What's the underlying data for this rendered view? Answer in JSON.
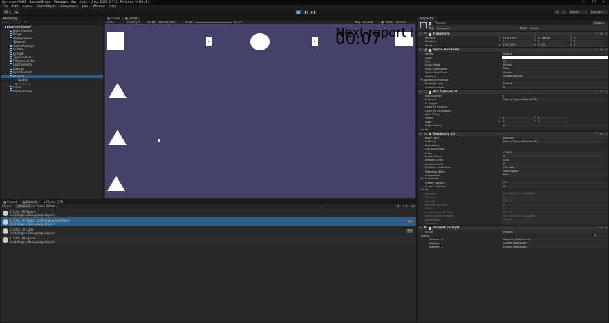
{
  "window": {
    "title": "GamelamQ083 - SampleScene - Windows, Mac, Linux - Unity 2022.3.11f1 Personal* <DX11>",
    "controls": [
      "–",
      "□",
      "✕"
    ]
  },
  "menu": [
    "File",
    "Edit",
    "Assets",
    "GameObject",
    "Component",
    "Jobs",
    "Window",
    "Help"
  ],
  "toolbar": {
    "account": "SD ▾",
    "play_icons": [
      "▶",
      "❚❚",
      "▶❚"
    ],
    "layers": "Layers",
    "layout": "Layout"
  },
  "hierarchy": {
    "tab": "Hierarchy",
    "search_placeholder": "All",
    "add": "+ ▾",
    "items": [
      {
        "label": "SampleScene*",
        "indent": 0,
        "state": "scene"
      },
      {
        "label": "Main Camera",
        "indent": 1,
        "state": "normal"
      },
      {
        "label": "Player",
        "indent": 1,
        "state": "normal"
      },
      {
        "label": "Itemspawner",
        "indent": 1,
        "state": "normal"
      },
      {
        "label": "Spawner",
        "indent": 1,
        "state": "normal"
      },
      {
        "label": "GameManager",
        "indent": 1,
        "state": "normal"
      },
      {
        "label": "Crafter",
        "indent": 1,
        "state": "normal"
      },
      {
        "label": "Output",
        "indent": 1,
        "state": "normal"
      },
      {
        "label": "TypeSelector",
        "indent": 1,
        "state": "normal"
      },
      {
        "label": "RibbonSelector",
        "indent": 1,
        "state": "normal"
      },
      {
        "label": "ColorSelector",
        "indent": 1,
        "state": "normal"
      },
      {
        "label": "Canvas",
        "indent": 1,
        "state": "normal"
      },
      {
        "label": "EventSystem",
        "indent": 1,
        "state": "normal"
      },
      {
        "label": "Present",
        "indent": 1,
        "state": "selected"
      },
      {
        "label": "Ribbon",
        "indent": 2,
        "state": "normal"
      },
      {
        "label": "ColorCat",
        "indent": 2,
        "state": "dim"
      },
      {
        "label": "Cross",
        "indent": 1,
        "state": "normal"
      },
      {
        "label": "PresentClone",
        "indent": 1,
        "state": "normal"
      }
    ]
  },
  "scene_tabs": [
    "Scene",
    "Game"
  ],
  "game_bar": {
    "mode": "Game",
    "display": "Display 1",
    "resolution": "Full HD (1920x1080)",
    "scale_label": "Scale",
    "scale_value": "0.47x",
    "play_focused": "Play Focused",
    "stats": "Stats",
    "gizmos": "Gizmos"
  },
  "game_ui": {
    "next_report": "Next report in :",
    "timer": "00:07"
  },
  "bottom_tabs": [
    "Project",
    "Console",
    "Plastic SCM"
  ],
  "console_bar": {
    "clear": "Clear ▾",
    "collapse": "Collapse",
    "error_pause": "Error Pause",
    "editor": "Editor ▾",
    "counts": [
      "4",
      "0",
      "0"
    ]
  },
  "console": [
    {
      "line1": "[15:04:19] Square",
      "line2": "UnityEngine.Debug:Log (object)",
      "count": "",
      "state": "normal"
    },
    {
      "line1": "[15:04:19] Ribbon (UnityEngine.Transform)",
      "line2": "UnityEngine.Debug:Log (object)",
      "count": "134",
      "state": "selected"
    },
    {
      "line1": "[15:04:17] Cross",
      "line2": "UnityEngine.Debug:Log (object)",
      "count": "134",
      "state": "normal"
    },
    {
      "line1": "[15:04:19] Square",
      "line2": "UnityEngine.Debug:Log (object)",
      "count": "",
      "state": "alt"
    }
  ],
  "inspector": {
    "tab": "Inspector",
    "object_name": "Present",
    "static": "Static ▾",
    "tag_label": "Tag",
    "tag": "Untagged",
    "layer_label": "Layer",
    "layer": "Default",
    "transform": {
      "title": "Transform",
      "position": {
        "label": "Position",
        "x": "0.1902957",
        "y": "4.128988",
        "z": "0"
      },
      "rotation": {
        "label": "Rotation",
        "x": "0",
        "y": "0",
        "z": "0"
      },
      "scale": {
        "label": "Scale",
        "x": "0.5413637",
        "y": "0.525",
        "z": "1"
      }
    },
    "sprite_renderer": {
      "title": "Sprite Renderer",
      "fields": [
        {
          "label": "Sprite",
          "value": "Square"
        },
        {
          "label": "Color",
          "value": ""
        },
        {
          "label": "Flip",
          "value": "X   Y"
        },
        {
          "label": "Draw Mode",
          "value": "Simple"
        },
        {
          "label": "Mask Interaction",
          "value": "None"
        },
        {
          "label": "Sprite Sort Point",
          "value": "Center"
        },
        {
          "label": "Material",
          "value": "Sprites-Default"
        }
      ],
      "additional": "Additional Settings",
      "sorting_layer": {
        "label": "Sorting Layer",
        "value": "Default"
      },
      "order": {
        "label": "Order in Layer",
        "value": "0"
      }
    },
    "box_collider": {
      "title": "Box Collider 2D",
      "edit_label": "Edit Collider",
      "fields": [
        {
          "label": "Material",
          "value": "None (Physics Material 2D)"
        },
        {
          "label": "Is Trigger",
          "value": ""
        },
        {
          "label": "Used By Effector",
          "value": ""
        },
        {
          "label": "Used By Composite",
          "value": ""
        },
        {
          "label": "Auto Tiling",
          "value": ""
        }
      ],
      "offset": {
        "label": "Offset",
        "x": "0",
        "y": "0"
      },
      "size": {
        "label": "Size",
        "x": "1",
        "y": "1"
      },
      "edge_radius": {
        "label": "Edge Radius",
        "value": "0"
      },
      "info": "Info"
    },
    "rigidbody": {
      "title": "Rigidbody 2D",
      "fields": [
        {
          "label": "Body Type",
          "value": "Dynamic"
        },
        {
          "label": "Material",
          "value": "None (Physics Material 2D)"
        },
        {
          "label": "Simulated",
          "value": "✓"
        },
        {
          "label": "Use Auto Mass",
          "value": ""
        },
        {
          "label": "Mass",
          "value": "10000"
        },
        {
          "label": "Linear Drag",
          "value": "0"
        },
        {
          "label": "Angular Drag",
          "value": "0.05"
        },
        {
          "label": "Gravity Scale",
          "value": "0"
        },
        {
          "label": "Collision Detection",
          "value": "Discrete"
        },
        {
          "label": "Sleeping Mode",
          "value": "Start Awake"
        },
        {
          "label": "Interpolate",
          "value": "None"
        }
      ],
      "constraints": "Constraints",
      "freeze_position": {
        "label": "Freeze Position",
        "value": "X   Y"
      },
      "freeze_rotation": {
        "label": "Freeze Rotation",
        "value": "Z"
      },
      "info": "Info",
      "info_fields": [
        {
          "label": "Position",
          "value": "X 0.1902957    Y 4.128988"
        },
        {
          "label": "Rotation",
          "value": "0"
        },
        {
          "label": "Velocity",
          "value": "X 0    Y 0"
        },
        {
          "label": "Angular Velocity",
          "value": "0"
        },
        {
          "label": "Inertia",
          "value": "0"
        },
        {
          "label": "Local Center of Mass",
          "value": "X 0    Y 0"
        },
        {
          "label": "World Center of Mass",
          "value": "X 0.1902957    Y 4.128988"
        },
        {
          "label": "Sleep State",
          "value": "Awake"
        },
        {
          "label": "Contacts",
          "value": ""
        }
      ]
    },
    "script": {
      "title": "Present (Script)",
      "fields": [
        {
          "label": "Script",
          "value": "Present"
        }
      ],
      "points": {
        "label": "Points",
        "count": "3"
      },
      "elements": [
        {
          "label": "Element 0",
          "value": "Spawner (Transform)"
        },
        {
          "label": "Element 1",
          "value": "Crafter (Transform)"
        },
        {
          "label": "Element 2",
          "value": "Output (Transform)"
        }
      ]
    }
  }
}
